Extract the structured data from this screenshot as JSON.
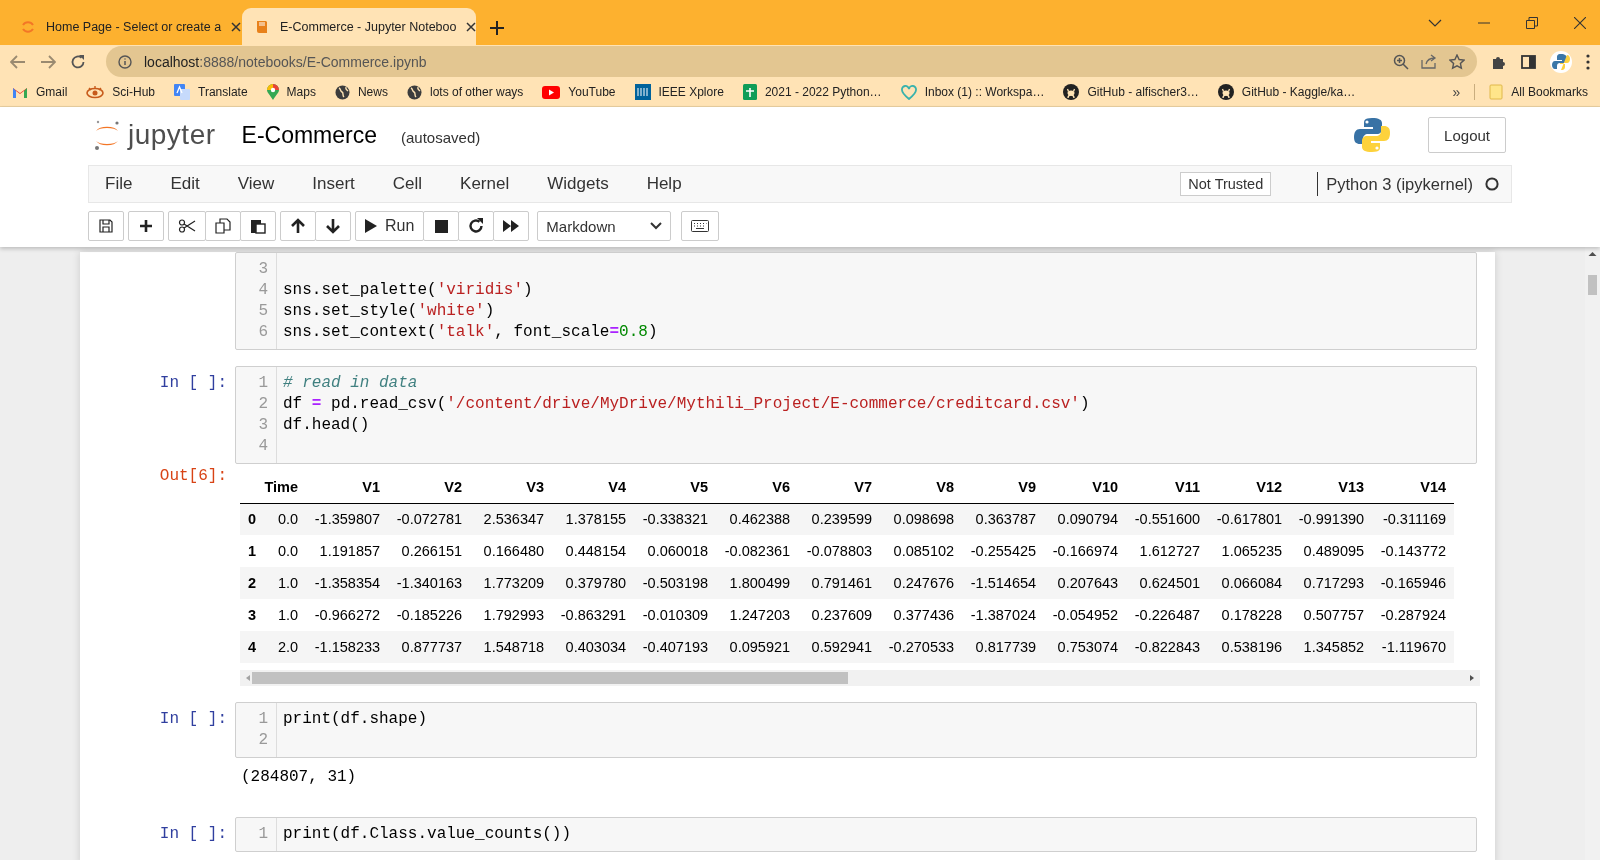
{
  "browser": {
    "tabs": [
      {
        "title": "Home Page - Select or create a",
        "selected": false
      },
      {
        "title": "E-Commerce - Jupyter Noteboo",
        "selected": true
      }
    ],
    "url_host": "localhost",
    "url_rest": ":8888/notebooks/E-Commerce.ipynb",
    "bookmarks": [
      {
        "label": "Gmail"
      },
      {
        "label": "Sci-Hub"
      },
      {
        "label": "Translate"
      },
      {
        "label": "Maps"
      },
      {
        "label": "News"
      },
      {
        "label": "lots of other ways"
      },
      {
        "label": "YouTube"
      },
      {
        "label": "IEEE Xplore"
      },
      {
        "label": "2021 - 2022 Python…"
      },
      {
        "label": "Inbox (1) :: Workspa…"
      },
      {
        "label": "GitHub - alfischer3…"
      },
      {
        "label": "GitHub - Kaggle/ka…"
      }
    ],
    "overflow": "»",
    "all_bookmarks": "All Bookmarks"
  },
  "jupyter": {
    "logo_text": "jupyter",
    "notebook_name": "E-Commerce",
    "save_status": "(autosaved)",
    "logout": "Logout",
    "menu": [
      "File",
      "Edit",
      "View",
      "Insert",
      "Cell",
      "Kernel",
      "Widgets",
      "Help"
    ],
    "trust": "Not Trusted",
    "kernel": "Python 3 (ipykernel)",
    "kernel_busy": false,
    "toolbar": {
      "run": "Run",
      "cell_type": "Markdown"
    }
  },
  "cells": [
    {
      "lines": [
        {
          "number": "3"
        },
        {
          "number": "4",
          "code": "sns.set_palette('viridis')"
        },
        {
          "number": "5",
          "code": "sns.set_style('white')"
        },
        {
          "number": "6",
          "code": "sns.set_context('talk', font_scale=0.8)"
        }
      ]
    },
    {
      "prompt": "In [ ]:",
      "lines": [
        {
          "number": "1",
          "code": "# read in data"
        },
        {
          "number": "2",
          "code": "df = pd.read_csv('/content/drive/MyDrive/Mythili_Project/E-commerce/creditcard.csv')"
        },
        {
          "number": "3",
          "code": "df.head()"
        },
        {
          "number": "4"
        }
      ],
      "output": {
        "kind": "table",
        "prompt": "Out[6]:",
        "columns": [
          "Time",
          "V1",
          "V2",
          "V3",
          "V4",
          "V5",
          "V6",
          "V7",
          "V8",
          "V9",
          "V10",
          "V11",
          "V12",
          "V13",
          "V14"
        ],
        "rows": [
          {
            "index": "0",
            "cells": [
              "0.0",
              "-1.359807",
              "-0.072781",
              "2.536347",
              "1.378155",
              "-0.338321",
              "0.462388",
              "0.239599",
              "0.098698",
              "0.363787",
              "0.090794",
              "-0.551600",
              "-0.617801",
              "-0.991390",
              "-0.311169"
            ]
          },
          {
            "index": "1",
            "cells": [
              "0.0",
              "1.191857",
              "0.266151",
              "0.166480",
              "0.448154",
              "0.060018",
              "-0.082361",
              "-0.078803",
              "0.085102",
              "-0.255425",
              "-0.166974",
              "1.612727",
              "1.065235",
              "0.489095",
              "-0.143772"
            ]
          },
          {
            "index": "2",
            "cells": [
              "1.0",
              "-1.358354",
              "-1.340163",
              "1.773209",
              "0.379780",
              "-0.503198",
              "1.800499",
              "0.791461",
              "0.247676",
              "-1.514654",
              "0.207643",
              "0.624501",
              "0.066084",
              "0.717293",
              "-0.165946"
            ]
          },
          {
            "index": "3",
            "cells": [
              "1.0",
              "-0.966272",
              "-0.185226",
              "1.792993",
              "-0.863291",
              "-0.010309",
              "1.247203",
              "0.237609",
              "0.377436",
              "-1.387024",
              "-0.054952",
              "-0.226487",
              "0.178228",
              "0.507757",
              "-0.287924"
            ]
          },
          {
            "index": "4",
            "cells": [
              "2.0",
              "-1.158233",
              "0.877737",
              "1.548718",
              "0.403034",
              "-0.407193",
              "0.095921",
              "0.592941",
              "-0.270533",
              "0.817739",
              "0.753074",
              "-0.822843",
              "0.538196",
              "1.345852",
              "-1.119670"
            ]
          }
        ]
      }
    },
    {
      "prompt": "In [ ]:",
      "lines": [
        {
          "number": "1",
          "code": "print(df.shape)"
        },
        {
          "number": "2"
        }
      ],
      "output": {
        "kind": "text",
        "text": "(284807, 31)"
      }
    },
    {
      "prompt": "In [ ]:",
      "lines": [
        {
          "number": "1",
          "code": "print(df.Class.value_counts())"
        }
      ]
    }
  ]
}
